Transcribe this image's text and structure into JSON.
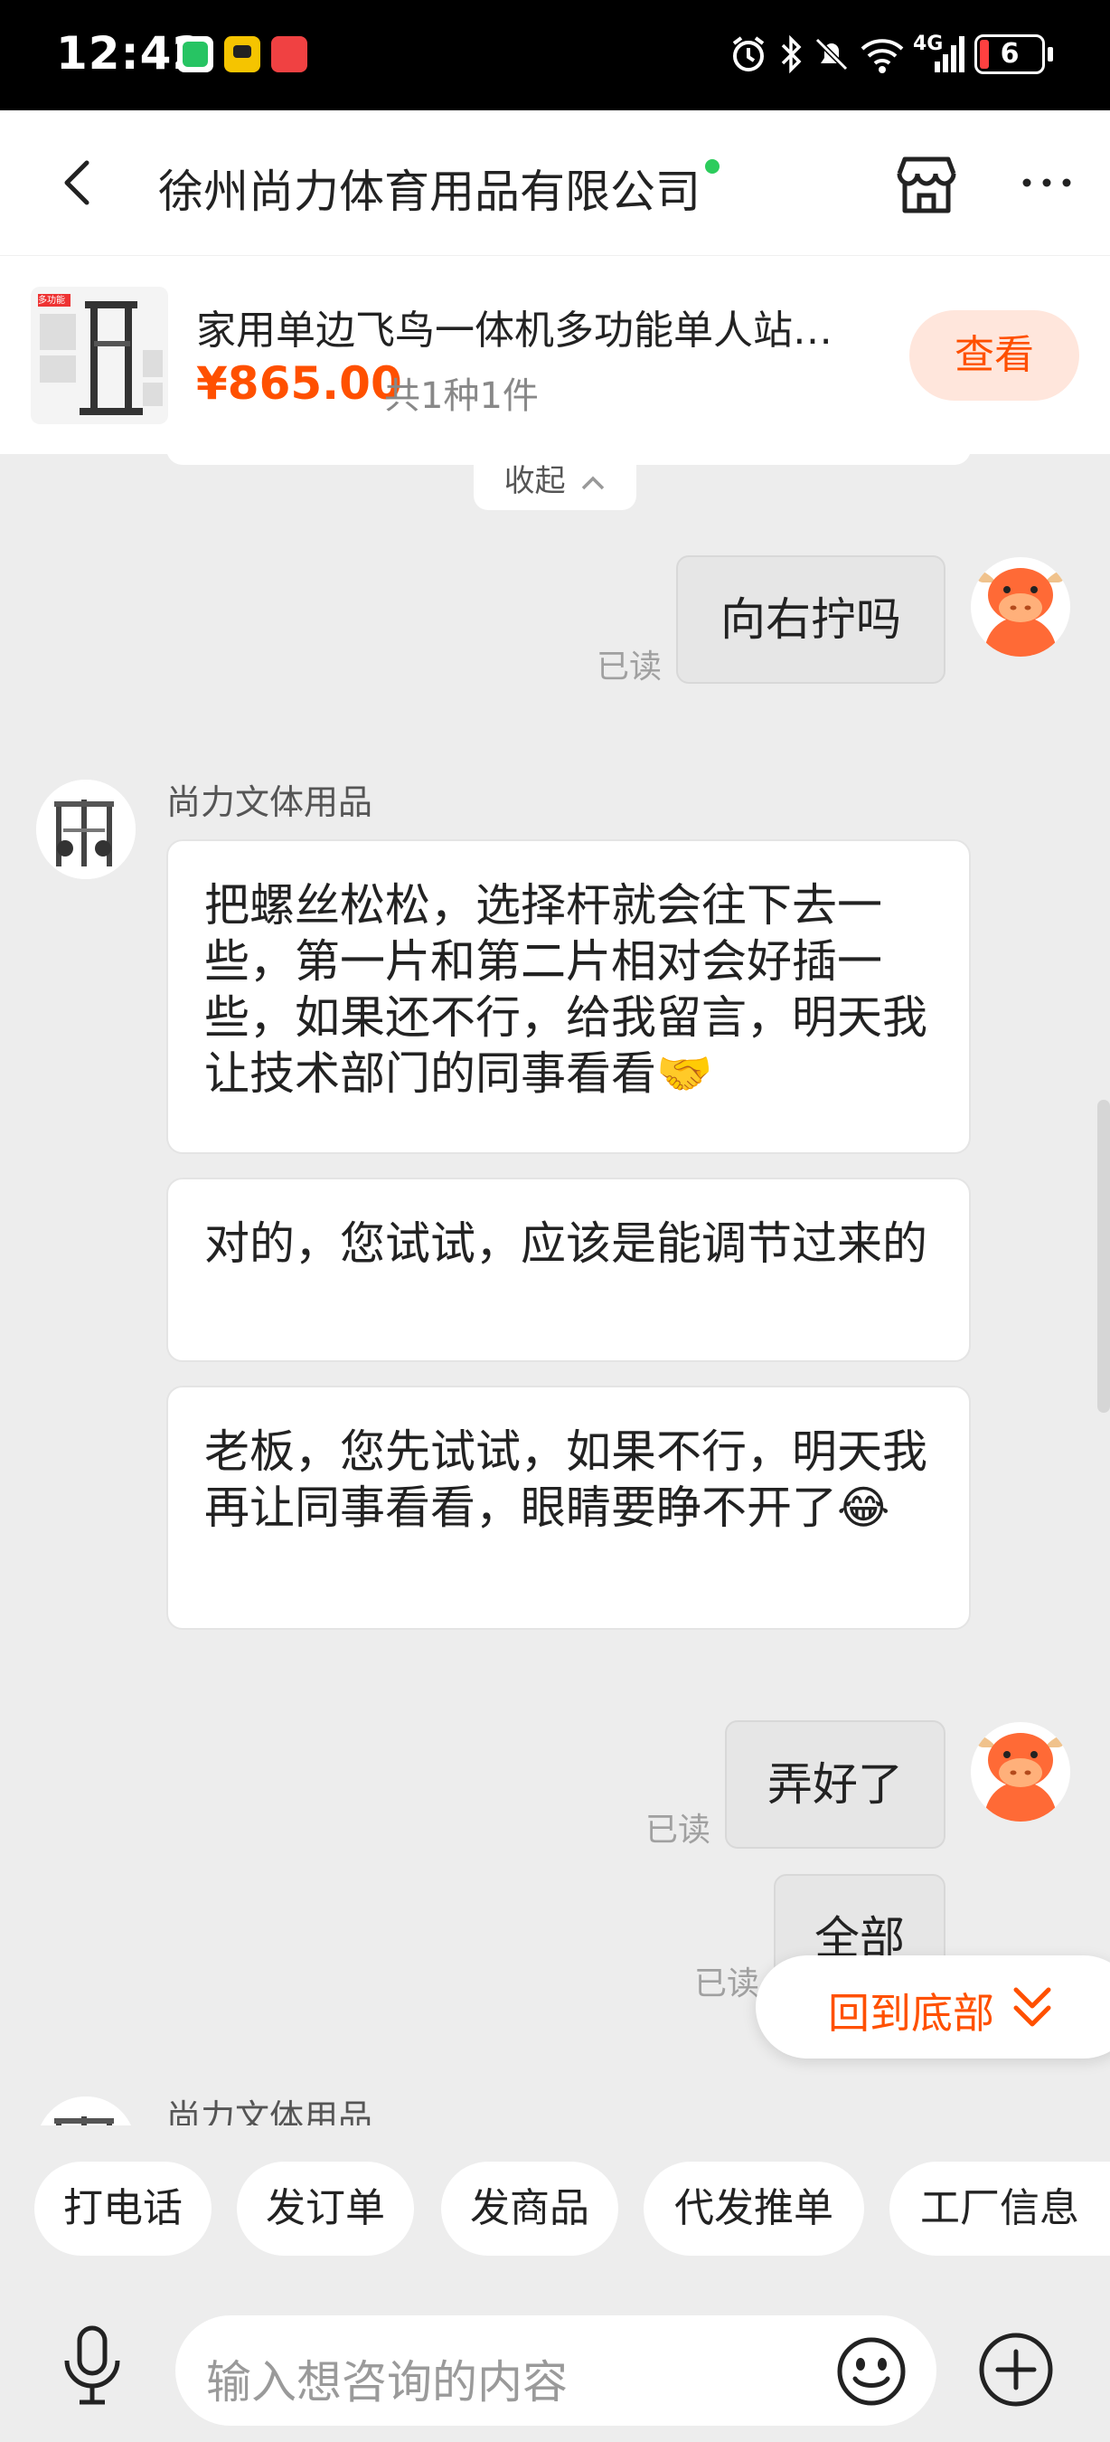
{
  "status_bar": {
    "time": "12:42",
    "network": "4G",
    "battery": "6"
  },
  "header": {
    "title": "徐州尚力体育用品有限公司",
    "online_color": "#2ccc5c"
  },
  "product": {
    "name": "家用单边飞鸟一体机多功能单人站…",
    "price": "¥865.00",
    "count": "共1种1件",
    "view_label": "查看",
    "thumb_text": "多功能"
  },
  "chat": {
    "collapse_label": "收起",
    "messages": [
      {
        "from": "me",
        "text": "向右拧吗",
        "status": "已读"
      },
      {
        "from": "shop",
        "sender": "尚力文体用品",
        "bubbles": [
          "把螺丝松松，选择杆就会往下去一些，第一片和第二片相对会好插一些，如果还不行，给我留言，明天我让技术部门的同事看看🤝",
          "对的，您试试，应该是能调节过来的",
          "老板，您先试试，如果不行，明天我再让同事看看，眼睛要睁不开了😂"
        ]
      },
      {
        "from": "me",
        "text": "弄好了",
        "status": "已读"
      },
      {
        "from": "me",
        "text": "全部",
        "status": "已读"
      },
      {
        "from": "shop",
        "sender": "尚力文体用品"
      }
    ],
    "to_bottom_label": "回到底部"
  },
  "quick_actions": [
    "打电话",
    "发订单",
    "发商品",
    "代发推单",
    "工厂信息"
  ],
  "input": {
    "placeholder": "输入想咨询的内容"
  },
  "colors": {
    "accent": "#ff5000",
    "bubble_me": "#e6e6e6",
    "background": "#ededed"
  }
}
